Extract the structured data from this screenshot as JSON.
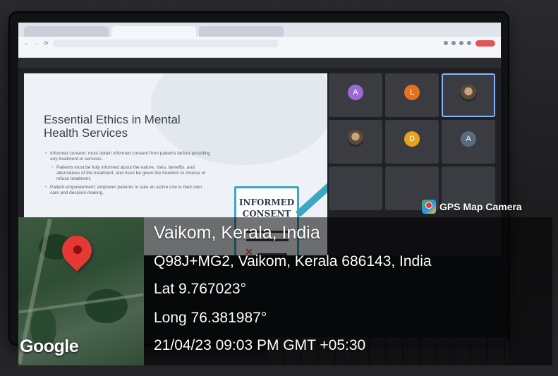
{
  "browser": {
    "tabs": [
      "",
      "",
      ""
    ],
    "url": "",
    "bookmarks": []
  },
  "meet": {
    "presenting_banner": "",
    "slide": {
      "title": "Essential Ethics in Mental Health Services",
      "bullets": [
        {
          "text": "Informed consent: must obtain informed consent from patients before providing any treatment or services.",
          "level": 1
        },
        {
          "text": "Patients must be fully informed about the nature, risks, benefits, and alternatives of the treatment, and must be given the freedom to choose or refuse treatment.",
          "level": 2
        },
        {
          "text": "Patient empowerment: empower patients to take an active role in their own care and decision-making.",
          "level": 1
        }
      ],
      "graphic_text_line1": "INFORMED",
      "graphic_text_line2": "CONSENT"
    },
    "tiles": [
      {
        "initial": "A",
        "color": "#9c6ad6"
      },
      {
        "initial": "L",
        "color": "#e8711c"
      },
      {
        "initial": "",
        "color": ""
      },
      {
        "initial": "",
        "color": ""
      },
      {
        "initial": "D",
        "color": "#e8a21c"
      },
      {
        "initial": "A",
        "color": "#5a6b80"
      }
    ]
  },
  "overlay": {
    "app_label": "GPS Map Camera",
    "city": "Vaikom, Kerala, India",
    "address": "Q98J+MG2, Vaikom, Kerala 686143, India",
    "lat": "Lat 9.767023°",
    "long": "Long 76.381987°",
    "datetime": "21/04/23 09:03 PM GMT +05:30",
    "map_brand": "Google"
  },
  "colors": {
    "pin": "#e53935",
    "accent_teal": "#3aa7c3",
    "meet_tile_highlight": "#8ab4f8"
  }
}
